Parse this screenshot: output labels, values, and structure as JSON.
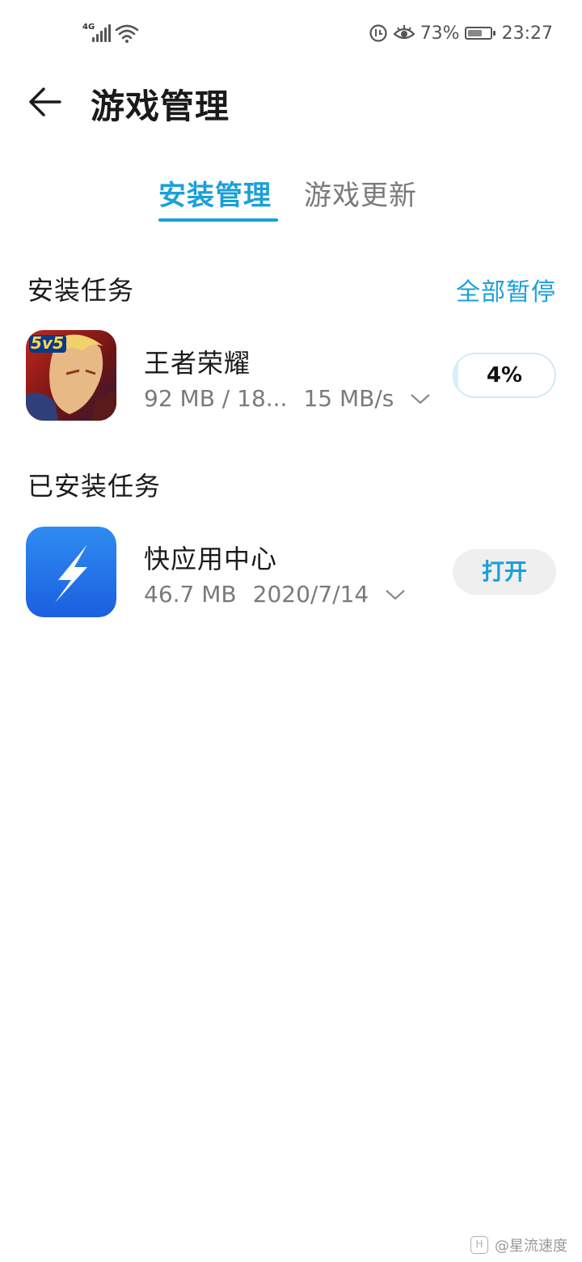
{
  "status_bar": {
    "network_label": "4G",
    "battery_percent": "73%",
    "battery_level": 0.73,
    "time": "23:27",
    "icons": [
      "signal-icon",
      "wifi-icon",
      "data-saver-icon",
      "eye-comfort-icon",
      "battery-icon"
    ]
  },
  "header": {
    "title": "游戏管理",
    "back_icon": "arrow-left-icon"
  },
  "tabs": [
    {
      "label": "安装管理",
      "active": true
    },
    {
      "label": "游戏更新",
      "active": false
    }
  ],
  "install_tasks": {
    "title": "安装任务",
    "action_label": "全部暂停",
    "items": [
      {
        "name": "王者荣耀",
        "size": "92 MB / 18...",
        "speed": "15 MB/s",
        "progress_label": "4%",
        "progress": 0.04,
        "icon_badge": "5v5"
      }
    ]
  },
  "installed_tasks": {
    "title": "已安装任务",
    "items": [
      {
        "name": "快应用中心",
        "size": "46.7 MB",
        "date": "2020/7/14",
        "action_label": "打开"
      }
    ]
  },
  "watermark": {
    "logo": "H",
    "text": "@星流速度"
  },
  "colors": {
    "accent": "#1aa0d8",
    "text_primary": "#1a1a1a",
    "text_secondary": "#7a7a7a",
    "button_bg": "#efefef"
  }
}
